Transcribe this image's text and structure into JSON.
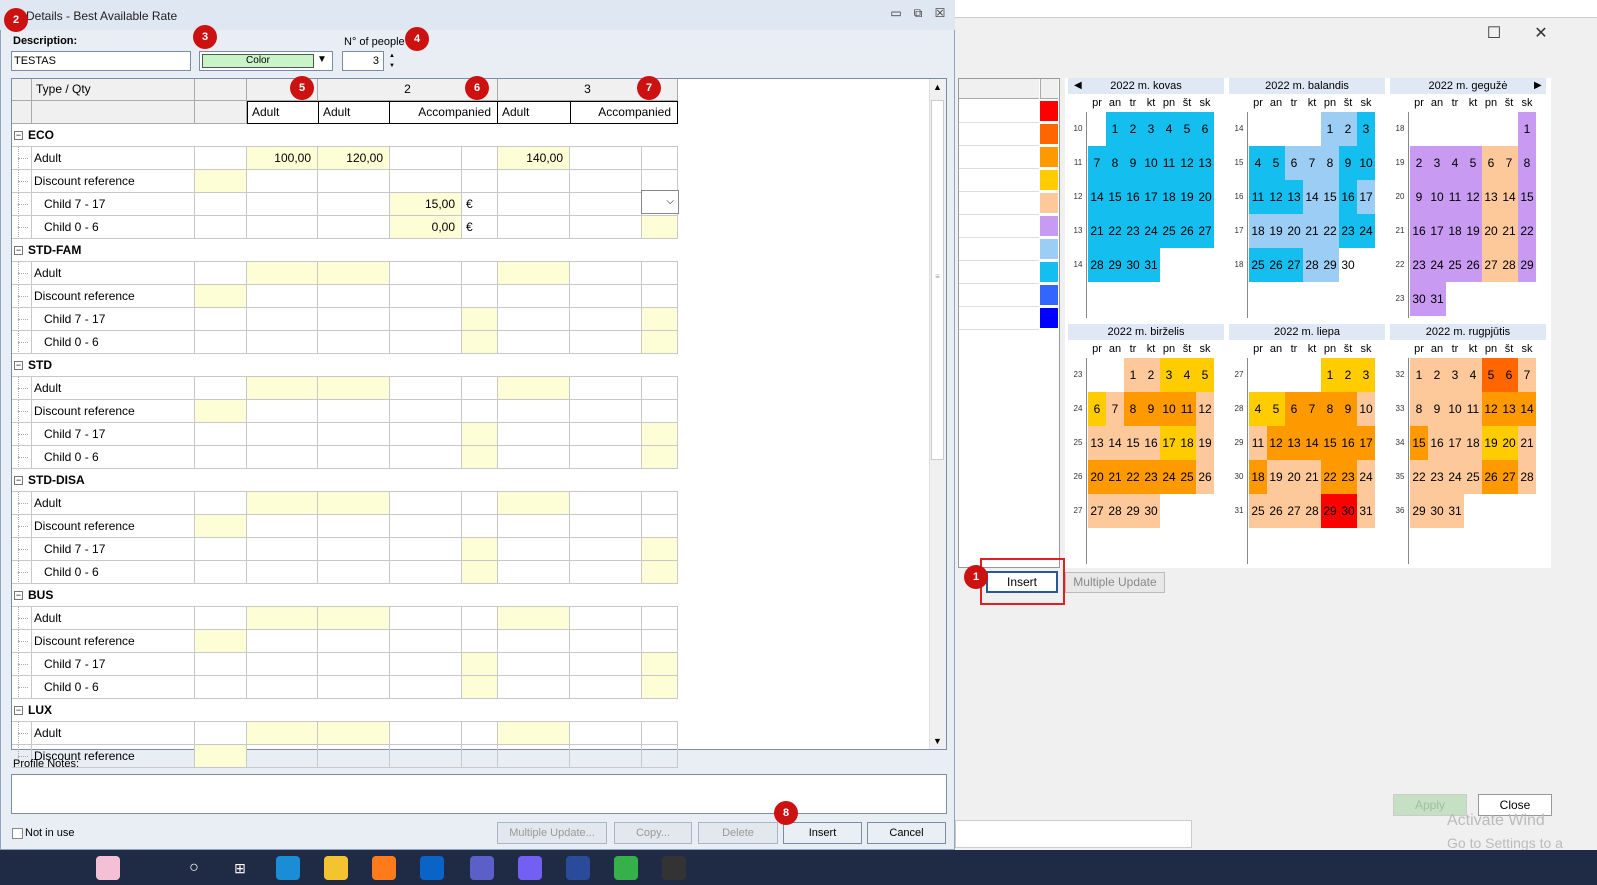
{
  "dialog": {
    "title": "Details - Best Available Rate",
    "description_label": "Description:",
    "description_value": "TESTAS",
    "color_label": "Color",
    "people_label": "N° of people",
    "people_value": "3",
    "profile_notes_label": "Profile Notes:",
    "not_in_use_label": "Not in use",
    "buttons": {
      "multiple_update": "Multiple Update...",
      "copy": "Copy...",
      "delete": "Delete",
      "insert": "Insert",
      "cancel": "Cancel"
    }
  },
  "grid": {
    "type_qty_header": "Type / Qty",
    "col_numbers": [
      "1",
      "2",
      "3"
    ],
    "sub_headers": [
      "Adult",
      "Adult",
      "Accompanied",
      "Adult",
      "Accompanied"
    ],
    "currency": "€",
    "groups": [
      {
        "name": "ECO",
        "adult": [
          "100,00",
          "120,00",
          "140,00"
        ],
        "child717": "15,00",
        "child06": "0,00"
      },
      {
        "name": "STD-FAM",
        "adult": [
          "",
          "",
          ""
        ],
        "child717": "",
        "child06": ""
      },
      {
        "name": "STD",
        "adult": [
          "",
          "",
          ""
        ],
        "child717": "",
        "child06": ""
      },
      {
        "name": "STD-DISA",
        "adult": [
          "",
          "",
          ""
        ],
        "child717": "",
        "child06": ""
      },
      {
        "name": "BUS",
        "adult": [
          "",
          "",
          ""
        ],
        "child717": "",
        "child06": ""
      },
      {
        "name": "LUX",
        "adult": [
          "",
          "",
          ""
        ],
        "child717": "",
        "child06": ""
      }
    ],
    "row_labels": {
      "adult": "Adult",
      "discount": "Discount reference",
      "child717": "Child 7 - 17",
      "child06": "Child 0 - 6"
    }
  },
  "background": {
    "insert_button": "Insert",
    "multiple_update_button": "Multiple Update",
    "apply_button": "Apply",
    "close_button": "Close",
    "watermark_line1": "Activate Wind",
    "watermark_line2": "Go to Settings to a",
    "color_legend": [
      "#ff0000",
      "#ff6600",
      "#ff9900",
      "#ffcc00",
      "#fdc89a",
      "#c89af2",
      "#9ccdf5",
      "#14bff0",
      "#3366ff",
      "#0000ff"
    ]
  },
  "calendar": {
    "weekdays": [
      "pr",
      "an",
      "tr",
      "kt",
      "pn",
      "št",
      "sk"
    ],
    "months": [
      {
        "title": "2022 m. kovas",
        "weeks": [
          "10",
          "11",
          "12",
          "13",
          "14"
        ]
      },
      {
        "title": "2022 m. balandis",
        "weeks": [
          "14",
          "15",
          "16",
          "17",
          "18"
        ]
      },
      {
        "title": "2022 m. gegužė",
        "weeks": [
          "18",
          "19",
          "20",
          "21",
          "22",
          "23"
        ]
      },
      {
        "title": "2022 m. birželis",
        "weeks": [
          "23",
          "24",
          "25",
          "26",
          "27"
        ]
      },
      {
        "title": "2022 m. liepa",
        "weeks": [
          "27",
          "28",
          "29",
          "30",
          "31"
        ]
      },
      {
        "title": "2022 m. rugpjūtis",
        "weeks": [
          "32",
          "33",
          "34",
          "35",
          "36"
        ]
      }
    ]
  },
  "badges": [
    "1",
    "2",
    "3",
    "4",
    "5",
    "6",
    "7",
    "8"
  ]
}
